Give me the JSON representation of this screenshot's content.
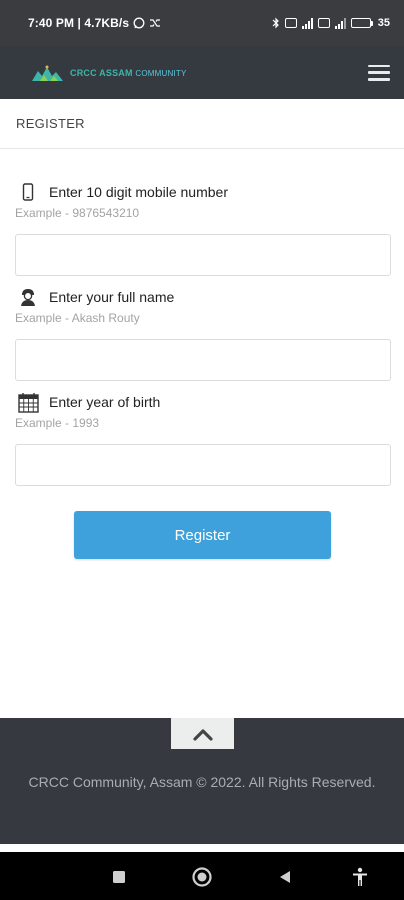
{
  "status_bar": {
    "time": "7:40 PM | 4.7KB/s",
    "battery_percent": "35",
    "battery_level": 0.35
  },
  "header": {
    "brand_bold": "CRCC ASSAM",
    "brand_light": "COMMUNITY",
    "menu_icon": "hamburger-icon"
  },
  "page": {
    "title": "REGISTER"
  },
  "form": {
    "fields": [
      {
        "icon": "phone-icon",
        "label": "Enter 10 digit mobile number",
        "example": "Example - 9876543210",
        "value": "",
        "placeholder": ""
      },
      {
        "icon": "user-icon",
        "label": "Enter your full name",
        "example": "Example - Akash Routy",
        "value": "",
        "placeholder": ""
      },
      {
        "icon": "calendar-icon",
        "label": "Enter year of birth",
        "example": "Example - 1993",
        "value": "",
        "placeholder": ""
      }
    ],
    "submit_label": "Register"
  },
  "footer": {
    "copyright": "CRCC Community, Assam © 2022. All Rights Reserved.",
    "scroll_icon": "chevron-up-icon"
  },
  "colors": {
    "header_bg": "#353a40",
    "accent": "#3ea1dc",
    "brand": "#3fb5a8",
    "footer_bg": "#363a40"
  },
  "nav_bar": {
    "icons": [
      "square-icon",
      "circle-home-icon",
      "back-triangle-icon",
      "accessibility-icon"
    ]
  }
}
